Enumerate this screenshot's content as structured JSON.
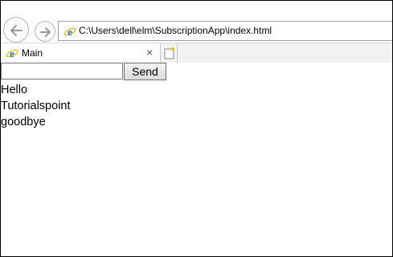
{
  "browser": {
    "address": "C:\\Users\\dell\\elm\\SubscriptionApp\\index.html",
    "tab": {
      "title": "Main",
      "close_glyph": "×"
    }
  },
  "page": {
    "input": {
      "value": "",
      "placeholder": ""
    },
    "send_label": "Send",
    "messages": [
      "Hello",
      "Tutorialspoint",
      "goodbye"
    ]
  },
  "colors": {
    "ie_logo": "#1e73c8",
    "ie_ring": "#f0b400"
  }
}
